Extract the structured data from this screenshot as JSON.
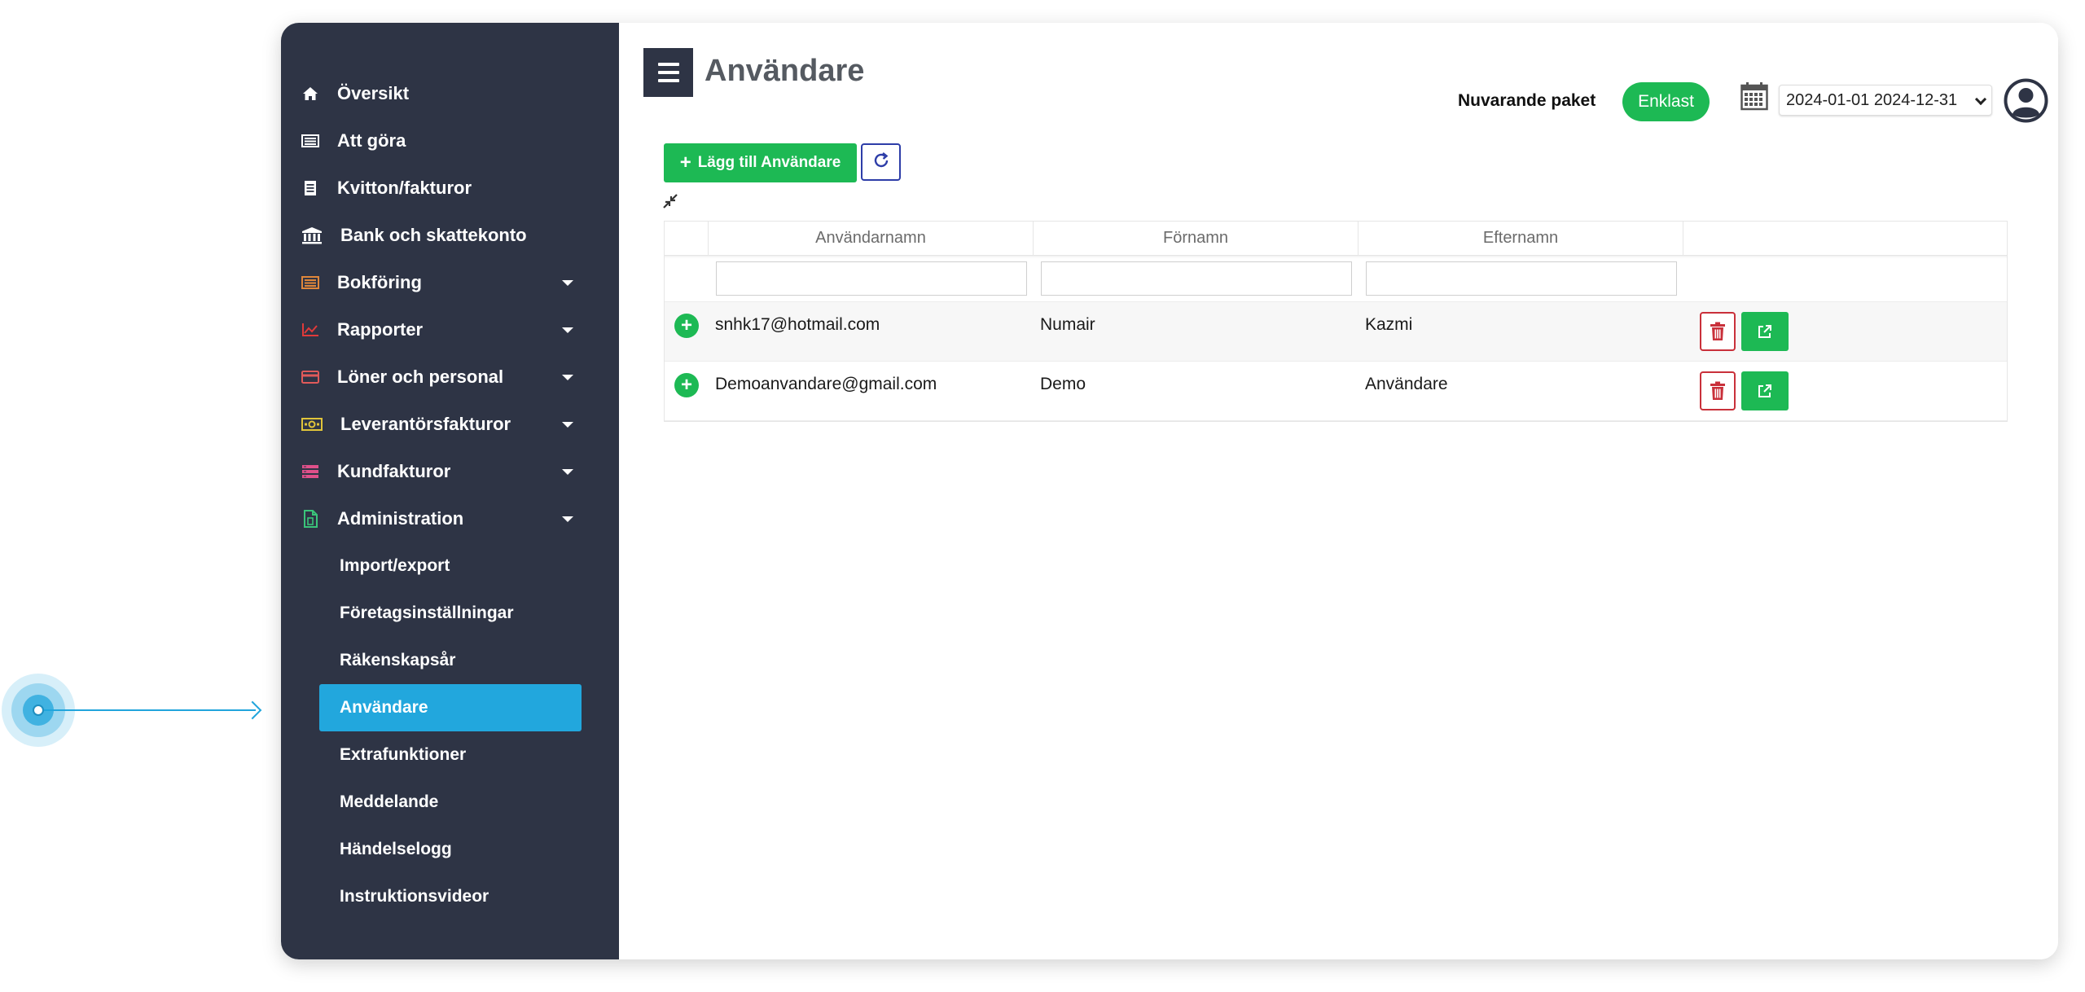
{
  "sidebar": {
    "items": [
      {
        "label": "Översikt",
        "icon": "home-icon",
        "color": "#ffffff",
        "expandable": false
      },
      {
        "label": "Att göra",
        "icon": "list-icon",
        "color": "#ffffff",
        "expandable": false
      },
      {
        "label": "Kvitton/fakturor",
        "icon": "receipt-icon",
        "color": "#ffffff",
        "expandable": false
      },
      {
        "label": "Bank och skattekonto",
        "icon": "bank-icon",
        "color": "#ffffff",
        "expandable": false
      },
      {
        "label": "Bokföring",
        "icon": "ledger-icon",
        "color": "#e0873a",
        "expandable": true
      },
      {
        "label": "Rapporter",
        "icon": "chart-icon",
        "color": "#e03a3a",
        "expandable": true
      },
      {
        "label": "Löner och personal",
        "icon": "card-icon",
        "color": "#e05a5a",
        "expandable": true
      },
      {
        "label": "Leverantörsfakturor",
        "icon": "money-icon",
        "color": "#e0c43a",
        "expandable": true
      },
      {
        "label": "Kundfakturor",
        "icon": "stack-icon",
        "color": "#e0508a",
        "expandable": true
      },
      {
        "label": "Administration",
        "icon": "document-icon",
        "color": "#3ac47a",
        "expandable": true
      }
    ],
    "admin_sub_items": [
      {
        "label": "Import/export",
        "active": false
      },
      {
        "label": "Företagsinställningar",
        "active": false
      },
      {
        "label": "Räkenskapsår",
        "active": false
      },
      {
        "label": "Användare",
        "active": true
      },
      {
        "label": "Extrafunktioner",
        "active": false
      },
      {
        "label": "Meddelande",
        "active": false
      },
      {
        "label": "Händelselogg",
        "active": false
      },
      {
        "label": "Instruktionsvideor",
        "active": false
      }
    ]
  },
  "header": {
    "title": "Användare",
    "plan_label": "Nuvarande paket",
    "plan_value": "Enklast",
    "date_range": "2024-01-01 2024-12-31"
  },
  "toolbar": {
    "add_label": "Lägg till Användare"
  },
  "table": {
    "columns": [
      "Användarnamn",
      "Förnamn",
      "Efternamn"
    ],
    "rows": [
      {
        "username": "snhk17@hotmail.com",
        "firstname": "Numair",
        "lastname": "Kazmi"
      },
      {
        "username": "Demoanvandare@gmail.com",
        "firstname": "Demo",
        "lastname": "Användare"
      }
    ]
  },
  "colors": {
    "sidebar_bg": "#2e3445",
    "active_item": "#22a7dd",
    "accent_green": "#1db954",
    "danger": "#c9303a"
  }
}
